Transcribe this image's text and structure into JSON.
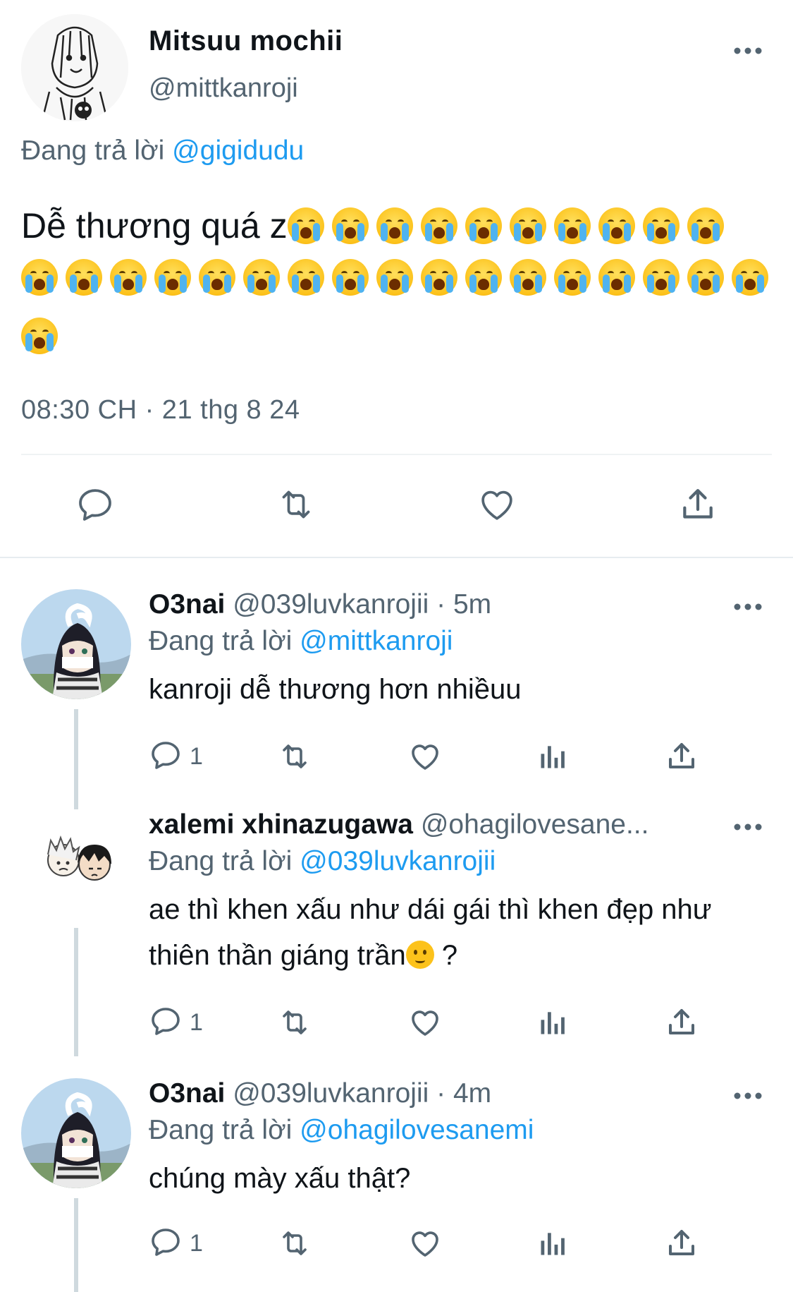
{
  "colors": {
    "accent": "#1d9bf0",
    "secondary_text": "#536471",
    "primary_text": "#0f1419"
  },
  "main_tweet": {
    "display_name": "Mitsuu mochii",
    "handle": "@mittkanroji",
    "reply_prefix": "Đang trả lời",
    "reply_to": "@gigidudu",
    "text": "Dễ thương quá z",
    "emoji_name": "loudly-crying-face-emoji",
    "emoji_count": 28,
    "timestamp": "08:30 CH · 21 thg 8 24"
  },
  "replies": [
    {
      "display_name": "O3nai",
      "handle": "@039luvkanrojii",
      "time": "· 5m",
      "reply_prefix": "Đang trả lời",
      "reply_to": "@mittkanroji",
      "text": "kanroji dễ thương hơn nhiềuu",
      "reply_count": "1"
    },
    {
      "display_name": "xalemi xhinazugawa",
      "handle": "@ohagilovesane...",
      "time": "",
      "reply_prefix": "Đang trả lời",
      "reply_to": "@039luvkanrojii",
      "text_line1": "ae thì khen xấu như dái gái thì khen đẹp như",
      "text_line2": "thiên thần giáng trần",
      "text_suffix": " ?",
      "reply_count": "1"
    },
    {
      "display_name": "O3nai",
      "handle": "@039luvkanrojii",
      "time": "· 4m",
      "reply_prefix": "Đang trả lời",
      "reply_to": "@ohagilovesanemi",
      "text": "chúng mày xấu thật?",
      "reply_count": "1"
    }
  ]
}
